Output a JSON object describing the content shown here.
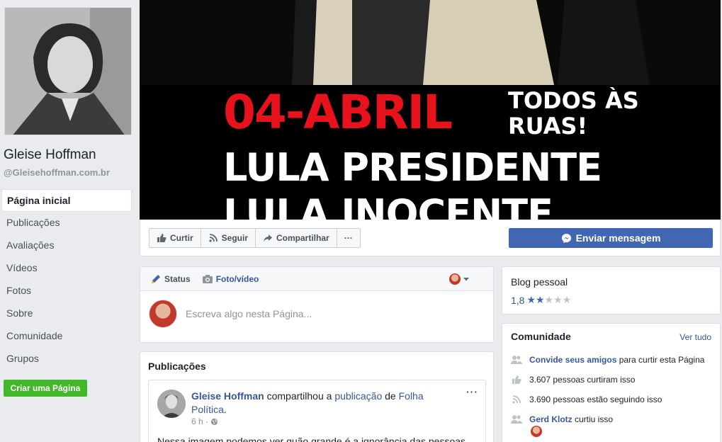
{
  "page": {
    "name": "Gleise Hoffman",
    "handle": "@Gleisehoffman.com.br"
  },
  "nav": {
    "items": [
      {
        "label": "Página inicial",
        "active": true
      },
      {
        "label": "Publicações"
      },
      {
        "label": "Avaliações"
      },
      {
        "label": "Vídeos"
      },
      {
        "label": "Fotos"
      },
      {
        "label": "Sobre"
      },
      {
        "label": "Comunidade"
      },
      {
        "label": "Grupos"
      }
    ],
    "create_page": "Criar uma Página"
  },
  "cover": {
    "line1": "04-ABRIL",
    "line1b_a": "TODOS ÀS",
    "line1b_b": "RUAS!",
    "line2": "LULA PRESIDENTE",
    "line3": "LULA INOCENTE"
  },
  "actions": {
    "like": "Curtir",
    "follow": "Seguir",
    "share": "Compartilhar",
    "more": "···",
    "send_message": "Enviar mensagem"
  },
  "composer": {
    "tab_status": "Status",
    "tab_photo": "Foto/vídeo",
    "placeholder": "Escreva algo nesta Página..."
  },
  "posts": {
    "title": "Publicações",
    "item": {
      "author": "Gleise Hoffman",
      "verb1": " compartilhou a ",
      "object": "publicação",
      "verb2": " de ",
      "source": "Folha Política",
      "end": ".",
      "time": "6 h",
      "sep": "·",
      "text": "Nessa imagem podemos ver quão grande é a ignorância das pessoas."
    }
  },
  "rating": {
    "category": "Blog pessoal",
    "score": "1,8",
    "value": 1.8,
    "max": 5
  },
  "community": {
    "title": "Comunidade",
    "see_all": "Ver tudo",
    "invite_link": "Convide seus amigos",
    "invite_rest": " para curtir esta Página",
    "likes": "3.607 pessoas curtiram isso",
    "followers": "3.690 pessoas estão seguindo isso",
    "friend_name": "Gerd Klotz",
    "friend_rest": " curtiu isso"
  },
  "colors": {
    "brand": "#4267b2",
    "link": "#365899",
    "create_page_green": "#42b72a",
    "cover_red": "#e8121c"
  }
}
